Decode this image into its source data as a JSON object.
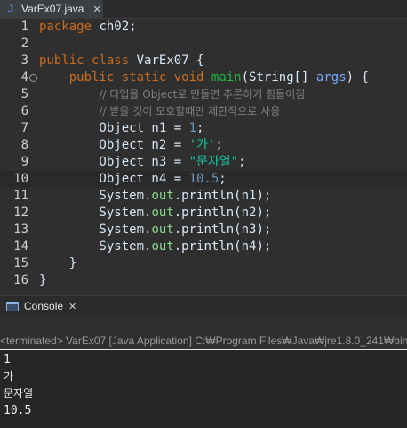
{
  "editor_tab": {
    "title": "VarEx07.java",
    "icon": "J",
    "close": "✕"
  },
  "code_lines": [
    {
      "no": "1",
      "tokens": [
        [
          "kw",
          "package"
        ],
        [
          "plain",
          " ch02;"
        ]
      ]
    },
    {
      "no": "2",
      "tokens": []
    },
    {
      "no": "3",
      "tokens": [
        [
          "kw",
          "public"
        ],
        [
          "plain",
          " "
        ],
        [
          "kw",
          "class"
        ],
        [
          "plain",
          " VarEx07 {"
        ]
      ]
    },
    {
      "no": "4",
      "fold": true,
      "tokens": [
        [
          "plain",
          "    "
        ],
        [
          "kw",
          "public"
        ],
        [
          "plain",
          " "
        ],
        [
          "kw",
          "static"
        ],
        [
          "plain",
          " "
        ],
        [
          "kw",
          "void"
        ],
        [
          "plain",
          " "
        ],
        [
          "method",
          "main"
        ],
        [
          "plain",
          "(String[] "
        ],
        [
          "param",
          "args"
        ],
        [
          "plain",
          ") {"
        ]
      ]
    },
    {
      "no": "5",
      "tokens": [
        [
          "plain",
          "        "
        ],
        [
          "cmt",
          "// 타입을 Object로 만들면 추론하기 힘들어짐"
        ]
      ]
    },
    {
      "no": "6",
      "tokens": [
        [
          "plain",
          "        "
        ],
        [
          "cmt",
          "// 받을 것이 모호할때만 제한적으로 사용"
        ]
      ]
    },
    {
      "no": "7",
      "tokens": [
        [
          "plain",
          "        Object n1 = "
        ],
        [
          "num",
          "1"
        ],
        [
          "plain",
          ";"
        ]
      ]
    },
    {
      "no": "8",
      "tokens": [
        [
          "plain",
          "        Object n2 = "
        ],
        [
          "str",
          "'가'"
        ],
        [
          "plain",
          ";"
        ]
      ]
    },
    {
      "no": "9",
      "tokens": [
        [
          "plain",
          "        Object n3 = "
        ],
        [
          "str",
          "\"문자열\""
        ],
        [
          "plain",
          ";"
        ]
      ]
    },
    {
      "no": "10",
      "current": true,
      "tokens": [
        [
          "plain",
          "        Object n4 = "
        ],
        [
          "num",
          "10.5"
        ],
        [
          "plain",
          ";"
        ]
      ]
    },
    {
      "no": "11",
      "tokens": [
        [
          "plain",
          "        System."
        ],
        [
          "field",
          "out"
        ],
        [
          "plain",
          ".println(n1);"
        ]
      ]
    },
    {
      "no": "12",
      "tokens": [
        [
          "plain",
          "        System."
        ],
        [
          "field",
          "out"
        ],
        [
          "plain",
          ".println(n2);"
        ]
      ]
    },
    {
      "no": "13",
      "tokens": [
        [
          "plain",
          "        System."
        ],
        [
          "field",
          "out"
        ],
        [
          "plain",
          ".println(n3);"
        ]
      ]
    },
    {
      "no": "14",
      "tokens": [
        [
          "plain",
          "        System."
        ],
        [
          "field",
          "out"
        ],
        [
          "plain",
          ".println(n4);"
        ]
      ]
    },
    {
      "no": "15",
      "tokens": [
        [
          "plain",
          "    }"
        ]
      ]
    },
    {
      "no": "16",
      "tokens": [
        [
          "plain",
          "}"
        ]
      ]
    }
  ],
  "console": {
    "tab_label": "Console",
    "close": "✕",
    "status": "<terminated> VarEx07 [Java Application] C:₩Program Files₩Java₩jre1.8.0_241₩bin₩",
    "output": [
      "1",
      "가",
      "문자열",
      "10.5"
    ]
  },
  "colors": {
    "keyword": "#cc6c1d",
    "string": "#17c6a3",
    "number": "#6897bb",
    "method": "#1eb540",
    "comment": "#808080"
  }
}
